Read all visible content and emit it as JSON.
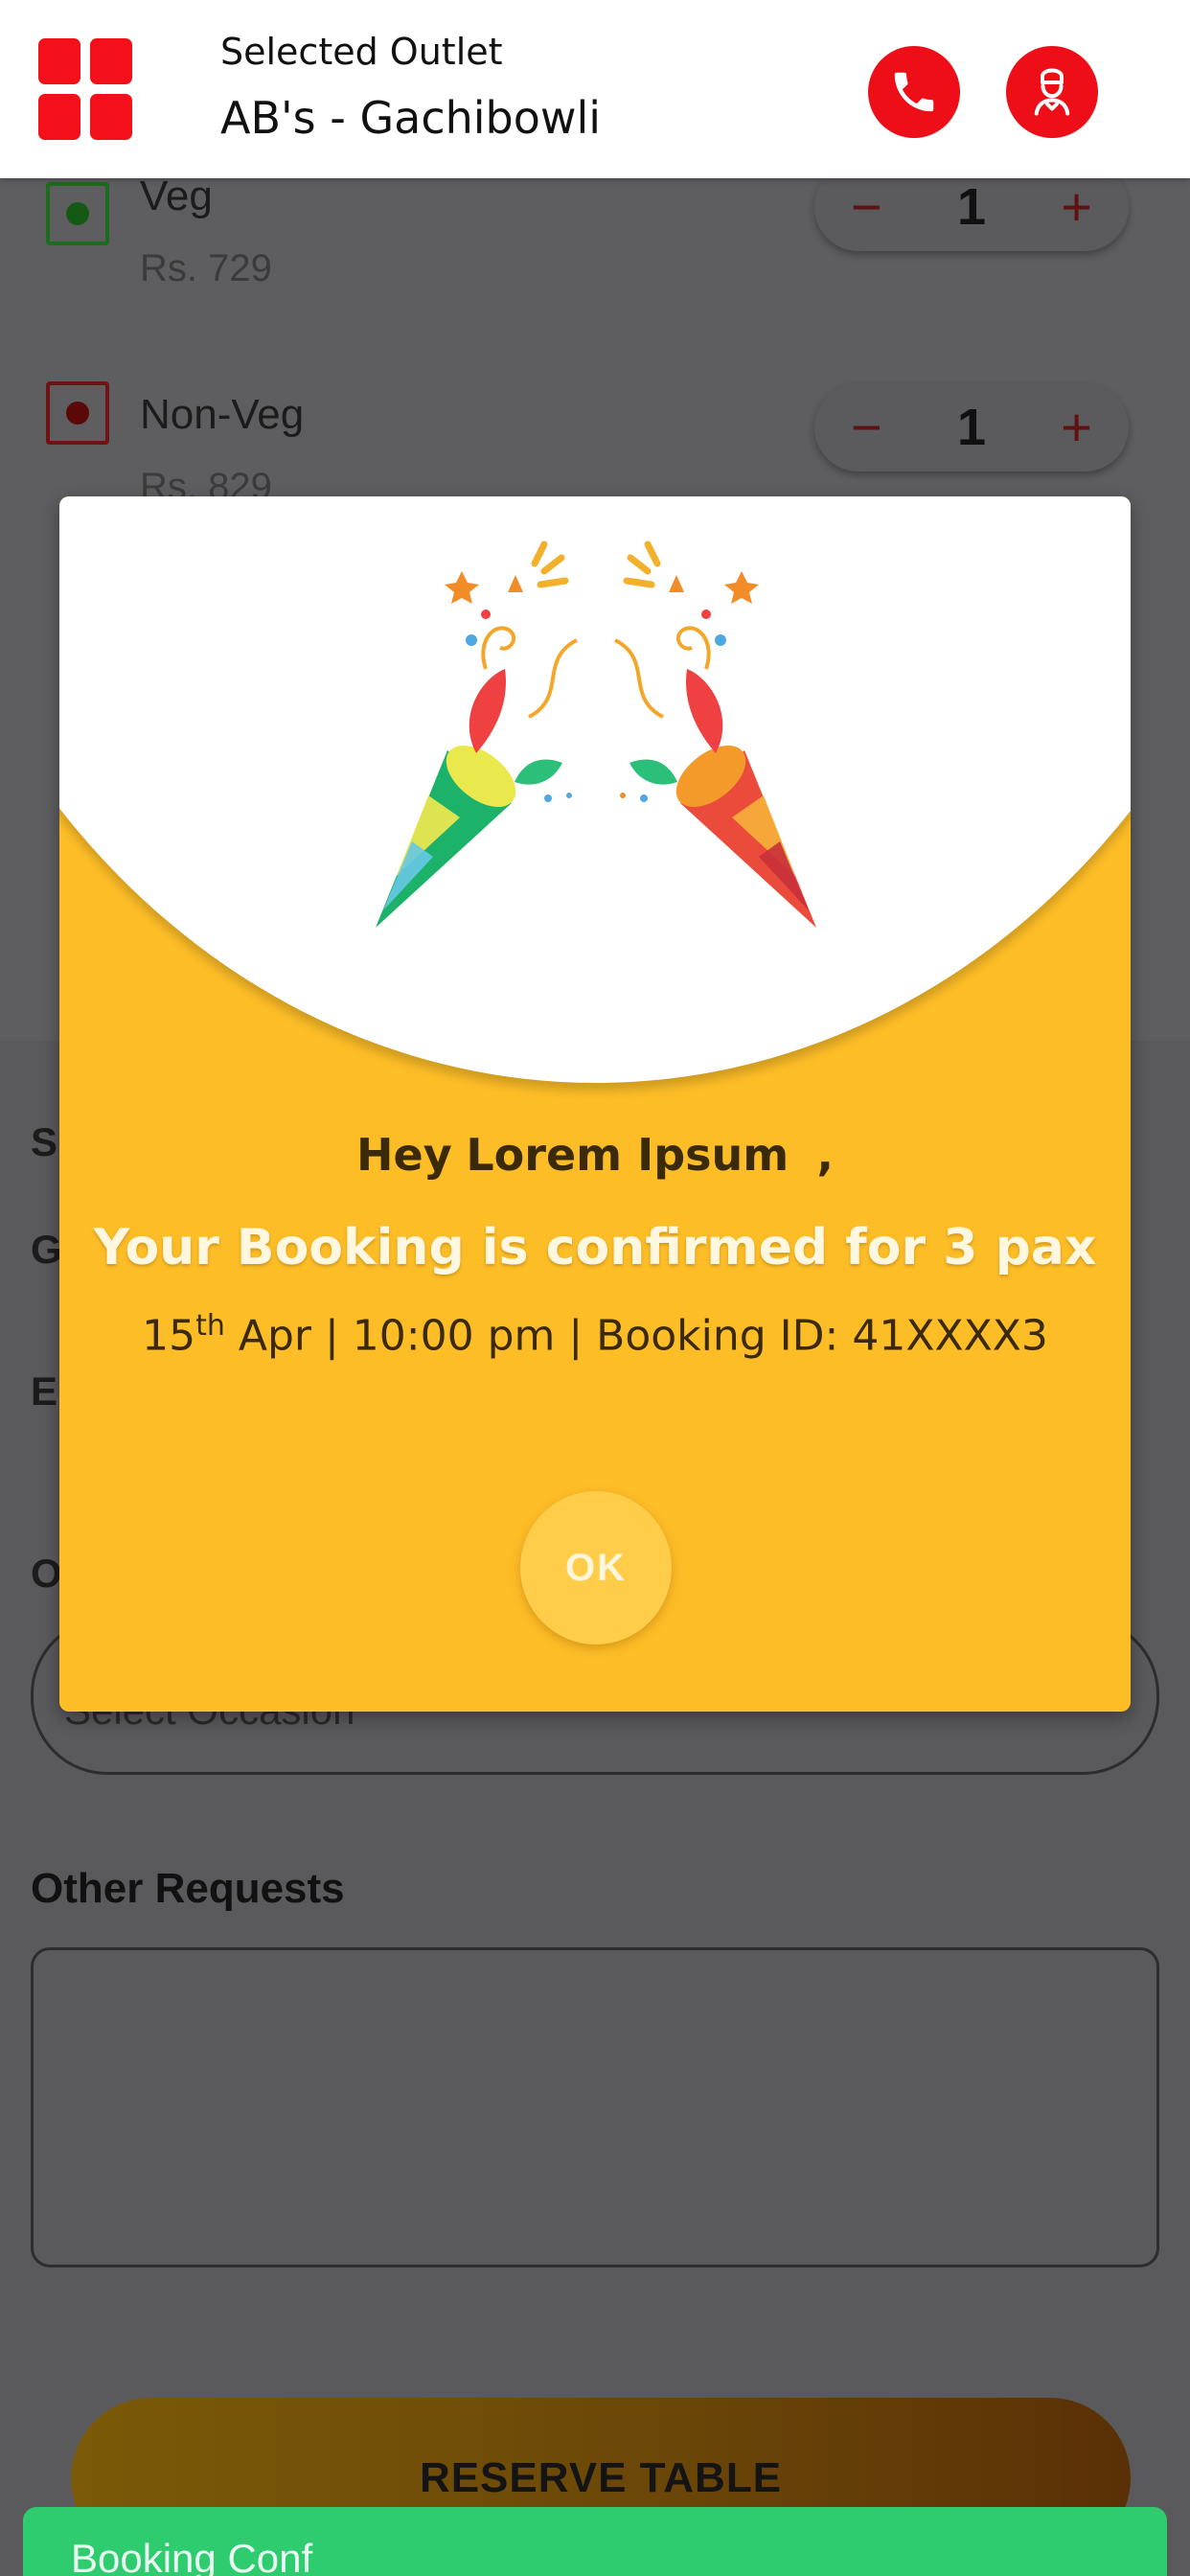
{
  "header": {
    "selected_outlet_label": "Selected Outlet",
    "outlet_name": "AB's - Gachibowli",
    "icons": {
      "menu": "grid-icon",
      "call": "phone-icon",
      "chef": "chef-icon"
    },
    "accent_color": "#f4101a"
  },
  "menu_items": [
    {
      "name": "Veg",
      "price": "Rs. 729",
      "quantity": "1",
      "type": "veg",
      "minus": "−",
      "plus": "+"
    },
    {
      "name": "Non-Veg",
      "price": "Rs. 829",
      "quantity": "1",
      "type": "non-veg",
      "minus": "−",
      "plus": "+"
    }
  ],
  "form": {
    "section_letters": [
      "S",
      "G",
      "E",
      "O"
    ],
    "occasion_placeholder": "Select Occasion",
    "other_requests_label": "Other Requests",
    "other_requests_value": ""
  },
  "reserve_button_label": "RESERVE TABLE",
  "toast_text": "Booking Conf",
  "modal": {
    "greeting_prefix": "Hey",
    "user_name": "Lorem Ipsum",
    "greeting_suffix": ",",
    "confirmation": "Your Booking is confirmed for 3 pax",
    "date_day": "15",
    "date_suffix": "th",
    "details_rest": " Apr | 10:00 pm | Booking ID: 41XXXX3",
    "ok_label": "OK",
    "background_color": "#fdbd27",
    "illustration": "party-popper-icon"
  }
}
